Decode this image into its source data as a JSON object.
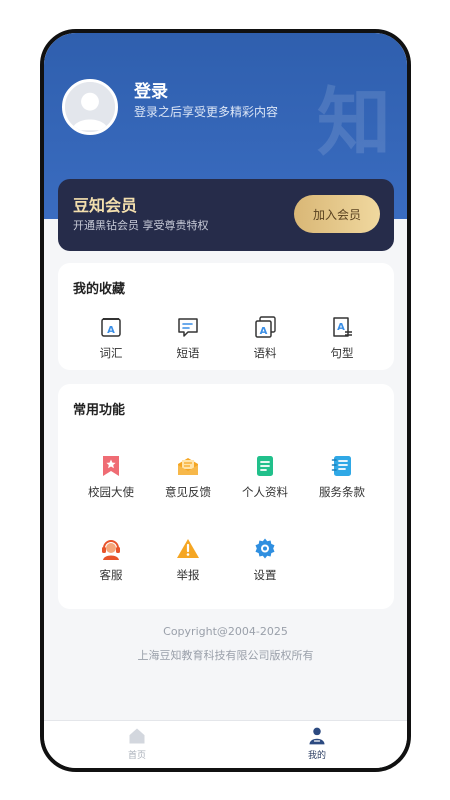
{
  "header": {
    "watermark": "知",
    "login_title": "登录",
    "login_subtitle": "登录之后享受更多精彩内容"
  },
  "vip": {
    "title": "豆知会员",
    "subtitle": "开通黑钻会员 享受尊贵特权",
    "button_label": "加入会员"
  },
  "favorites": {
    "title": "我的收藏",
    "items": [
      {
        "label": "词汇",
        "icon": "vocabulary-icon"
      },
      {
        "label": "短语",
        "icon": "phrase-icon"
      },
      {
        "label": "语料",
        "icon": "corpus-icon"
      },
      {
        "label": "句型",
        "icon": "sentence-pattern-icon"
      }
    ]
  },
  "functions": {
    "title": "常用功能",
    "items": [
      {
        "label": "校园大使",
        "icon": "ambassador-bookmark-icon"
      },
      {
        "label": "意见反馈",
        "icon": "feedback-mail-icon"
      },
      {
        "label": "个人资料",
        "icon": "profile-document-icon"
      },
      {
        "label": "服务条款",
        "icon": "terms-notebook-icon"
      },
      {
        "label": "客服",
        "icon": "customer-service-icon"
      },
      {
        "label": "举报",
        "icon": "report-warning-icon"
      },
      {
        "label": "设置",
        "icon": "settings-gear-icon"
      }
    ]
  },
  "footer": {
    "copyright": "Copyright@2004-2025",
    "company": "上海豆知教育科技有限公司版权所有"
  },
  "tabbar": {
    "home_label": "首页",
    "me_label": "我的"
  },
  "colors": {
    "header_blue": "#2f5fae",
    "vip_bg": "#262c4a",
    "gold": "#e3c68a",
    "accent_blue": "#3a8ee6"
  }
}
